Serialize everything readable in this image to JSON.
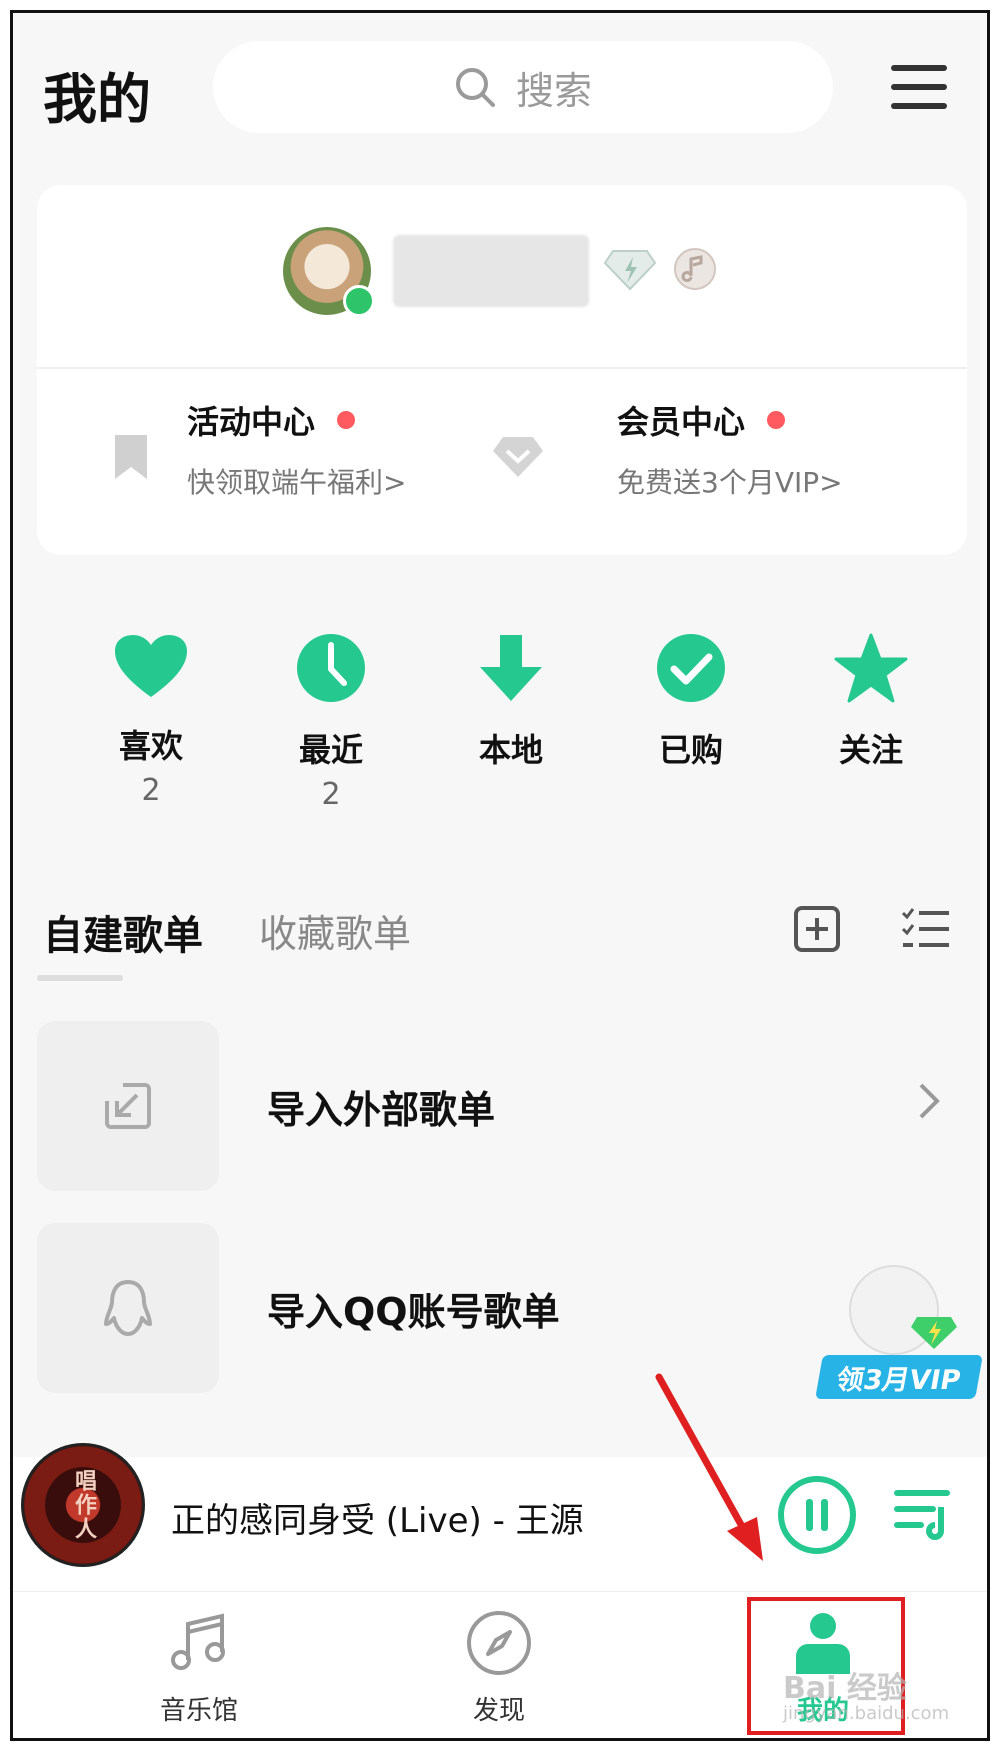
{
  "header": {
    "title": "我的",
    "search_placeholder": "搜索"
  },
  "profile": {
    "activity": {
      "title": "活动中心",
      "subtitle": "快领取端午福利>"
    },
    "member": {
      "title": "会员中心",
      "subtitle": "免费送3个月VIP>"
    }
  },
  "quick_actions": [
    {
      "label": "喜欢",
      "count": "2"
    },
    {
      "label": "最近",
      "count": "2"
    },
    {
      "label": "本地",
      "count": ""
    },
    {
      "label": "已购",
      "count": ""
    },
    {
      "label": "关注",
      "count": ""
    }
  ],
  "playlists": {
    "tab_self": "自建歌单",
    "tab_fav": "收藏歌单",
    "items": [
      {
        "label": "导入外部歌单"
      },
      {
        "label": "导入QQ账号歌单"
      }
    ]
  },
  "promo": {
    "label": "领3月VIP"
  },
  "player": {
    "song": "正的感同身受 (Live) - 王源",
    "album_text": "唱作人"
  },
  "nav": [
    {
      "label": "音乐馆"
    },
    {
      "label": "发现"
    },
    {
      "label": "我的"
    }
  ],
  "watermark": {
    "text": "Bai 经验",
    "sub": "jingyan.baidu.com"
  },
  "colors": {
    "accent": "#25c98f",
    "dot": "#ff5a5f",
    "annotation": "#e02020"
  }
}
